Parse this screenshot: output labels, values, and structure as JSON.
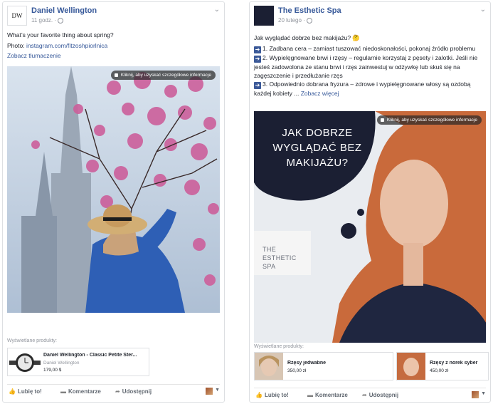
{
  "post1": {
    "page_name": "Daniel Wellington",
    "avatar_text": "DW",
    "time": "11 godz. ·",
    "text_line1": "What’s your favorite thing about spring?",
    "text_line2_prefix": "Photo: ",
    "text_line2_link": "instagram.com/fitzoshpiorlnica",
    "translate_link": "Zobacz tłumaczenie",
    "tooltip": "Kliknij, aby uzyskać szczegółowe informacje",
    "products_label": "Wyświetlane produkty:",
    "product": {
      "title": "Daniel Wellington - Classic Petite Ster...",
      "brand": "Daniel Wellington",
      "price": "179,00 $"
    },
    "actions": {
      "like": "Lubię to!",
      "comment": "Komentarze",
      "share": "Udostępnij"
    }
  },
  "post2": {
    "page_name": "The Esthetic Spa",
    "time": "20 lutego ·",
    "intro": "Jak wyglądać dobrze bez makijażu? 🤔",
    "item1": "1. Zadbana cera – zamiast tuszować niedoskonałości, pokonaj źródło problemu",
    "item2": "2. Wypielęgnowane brwi i rzęsy – regularnie korzystaj z pęsety i zalotki. Jeśli nie jesteś zadowolona ze stanu brwi i rzęs zainwestuj w odżywkę lub skuś się na zagęszczenie i przedłużanie rzęs",
    "item3": "3. Odpowiednio dobrana fryzura – zdrowe i wypielęgnowane włosy są ozdobą każdej kobiety ...",
    "see_more": "Zobacz więcej",
    "tooltip": "Kliknij, aby uzyskać szczegółowe informacje",
    "headline_l1": "JAK DOBRZE",
    "headline_l2": "WYGLĄDAĆ BEZ",
    "headline_l3": "MAKIJAŻU?",
    "logo_l1": "THE",
    "logo_l2": "ESTHETIC",
    "logo_l3": "SPA",
    "products_label": "Wyświetlane produkty:",
    "products": [
      {
        "title": "Rzęsy jedwabne",
        "price": "350,00 zł"
      },
      {
        "title": "Rzęsy z norek syber",
        "price": "450,00 zł"
      }
    ],
    "actions": {
      "like": "Lubię to!",
      "comment": "Komentarze",
      "share": "Udostępnij"
    }
  },
  "colors": {
    "link": "#365899",
    "navy": "#1b1f33",
    "border": "#dddfe2"
  },
  "icons": [
    "globe-icon",
    "chevron-down-icon",
    "like-icon",
    "comment-icon",
    "share-icon",
    "arrow-right-icon",
    "shopping-bag-icon"
  ]
}
